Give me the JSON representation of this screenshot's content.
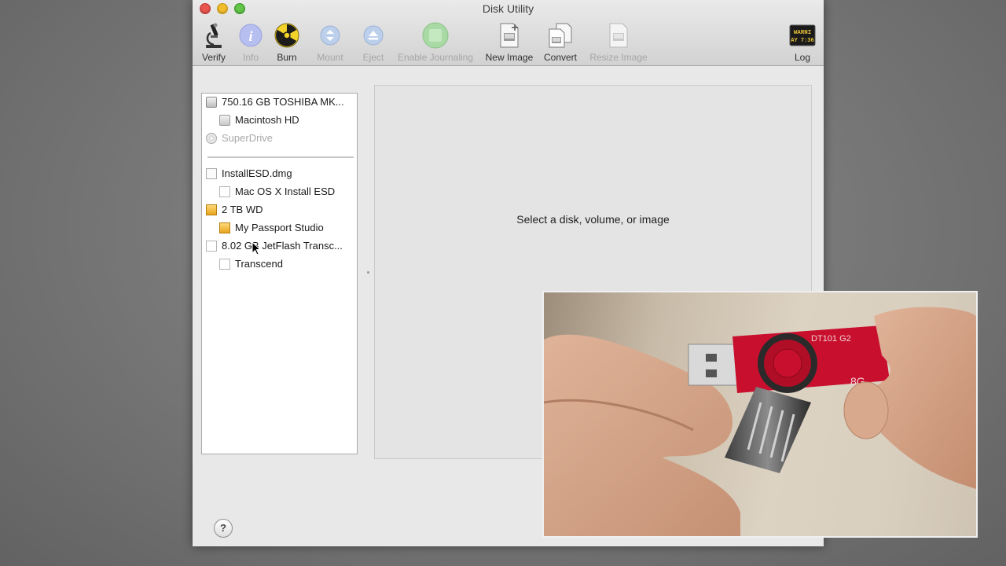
{
  "window": {
    "title": "Disk Utility"
  },
  "toolbar": {
    "items": [
      {
        "label": "Verify",
        "icon": "microscope-icon",
        "enabled": true
      },
      {
        "label": "Info",
        "icon": "info-icon",
        "enabled": false
      },
      {
        "label": "Burn",
        "icon": "burn-icon",
        "enabled": true
      },
      {
        "label": "Mount",
        "icon": "mount-icon",
        "enabled": false
      },
      {
        "label": "Eject",
        "icon": "eject-icon",
        "enabled": false
      },
      {
        "label": "Enable Journaling",
        "icon": "journaling-icon",
        "enabled": false
      },
      {
        "label": "New Image",
        "icon": "new-image-icon",
        "enabled": true
      },
      {
        "label": "Convert",
        "icon": "convert-icon",
        "enabled": true
      },
      {
        "label": "Resize Image",
        "icon": "resize-image-icon",
        "enabled": false
      },
      {
        "label": "Log",
        "icon": "log-icon",
        "enabled": true
      }
    ],
    "log_icon_text": [
      "WARNI",
      "AY 7:36"
    ]
  },
  "sidebar": {
    "items": [
      {
        "label": "750.16 GB TOSHIBA MK...",
        "icon": "hard-disk-icon",
        "indent": 0
      },
      {
        "label": "Macintosh HD",
        "icon": "volume-icon",
        "indent": 1
      },
      {
        "label": "SuperDrive",
        "icon": "optical-drive-icon",
        "indent": 0,
        "dimmed": true
      },
      {
        "label": "InstallESD.dmg",
        "icon": "disk-image-icon",
        "indent": 0
      },
      {
        "label": "Mac OS X Install ESD",
        "icon": "blank-volume-icon",
        "indent": 1
      },
      {
        "label": "2 TB WD",
        "icon": "external-disk-icon",
        "indent": 0
      },
      {
        "label": "My Passport Studio",
        "icon": "external-volume-icon",
        "indent": 1
      },
      {
        "label": "8.02 GB JetFlash Transc...",
        "icon": "usb-disk-icon",
        "indent": 0
      },
      {
        "label": "Transcend",
        "icon": "usb-volume-icon",
        "indent": 1
      }
    ]
  },
  "detail": {
    "message": "Select a disk, volume, or image"
  },
  "help": {
    "label": "?"
  },
  "photo": {
    "usb_label": "DT101 G2",
    "capacity_label": "8G"
  },
  "colors": {
    "usb_body": "#c8102e",
    "traffic_red": "#e9544e",
    "traffic_yellow": "#f2be2d",
    "traffic_green": "#63c64a"
  }
}
